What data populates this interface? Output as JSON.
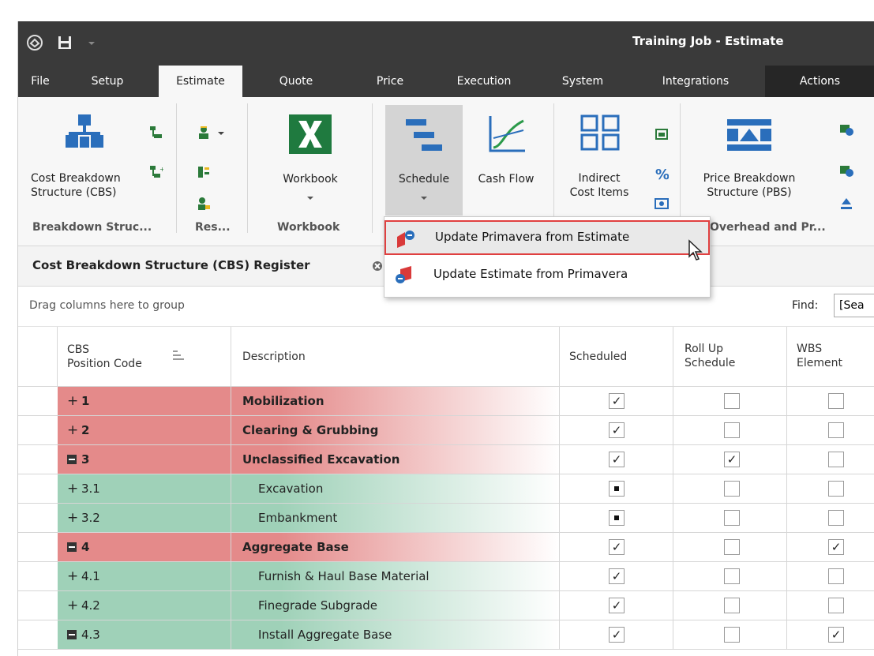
{
  "window": {
    "title": "Training Job - Estimate"
  },
  "menu": {
    "tabs": [
      {
        "label": "File"
      },
      {
        "label": "Setup"
      },
      {
        "label": "Estimate"
      },
      {
        "label": "Quote"
      },
      {
        "label": "Price"
      },
      {
        "label": "Execution"
      },
      {
        "label": "System"
      },
      {
        "label": "Integrations"
      },
      {
        "label": "Actions"
      }
    ],
    "active": "Estimate"
  },
  "ribbon": {
    "cbs_button": "Cost Breakdown\nStructure (CBS)",
    "workbook_button": "Workbook",
    "schedule_button": "Schedule",
    "cashflow_button": "Cash Flow",
    "indirect_button": "Indirect\nCost Items",
    "pbs_button": "Price Breakdown\nStructure (PBS)",
    "groups": {
      "breakdown": "Breakdown Struc...",
      "resources": "Res...",
      "workbook": "Workbook",
      "overhead": "Overhead and Pr..."
    }
  },
  "dropdown": {
    "items": [
      {
        "label": "Update Primavera from Estimate",
        "highlighted": true
      },
      {
        "label": "Update Estimate from Primavera",
        "highlighted": false
      }
    ]
  },
  "panel": {
    "title": "Cost Breakdown Structure (CBS) Register",
    "group_hint": "Drag columns here to group",
    "find_label": "Find:",
    "find_value": "[Sea"
  },
  "grid": {
    "headers": {
      "code": "CBS\nPosition Code",
      "description": "Description",
      "scheduled": "Scheduled",
      "rollup": "Roll Up\nSchedule",
      "wbs": "WBS\nElement"
    },
    "rows": [
      {
        "expander": "+",
        "code": "1",
        "description": "Mobilization",
        "level": 0,
        "scheduled": "checked",
        "rollup": "unchecked",
        "wbs": "unchecked"
      },
      {
        "expander": "+",
        "code": "2",
        "description": "Clearing & Grubbing",
        "level": 0,
        "scheduled": "checked",
        "rollup": "unchecked",
        "wbs": "unchecked"
      },
      {
        "expander": "-",
        "code": "3",
        "description": "Unclassified Excavation",
        "level": 0,
        "scheduled": "checked",
        "rollup": "checked",
        "wbs": "unchecked"
      },
      {
        "expander": "+",
        "code": "3.1",
        "description": "Excavation",
        "level": 1,
        "scheduled": "indeterminate",
        "rollup": "unchecked",
        "wbs": "unchecked"
      },
      {
        "expander": "+",
        "code": "3.2",
        "description": "Embankment",
        "level": 1,
        "scheduled": "indeterminate",
        "rollup": "unchecked",
        "wbs": "unchecked"
      },
      {
        "expander": "-",
        "code": "4",
        "description": "Aggregate Base",
        "level": 0,
        "scheduled": "checked",
        "rollup": "unchecked",
        "wbs": "checked"
      },
      {
        "expander": "+",
        "code": "4.1",
        "description": "Furnish & Haul Base Material",
        "level": 1,
        "scheduled": "checked",
        "rollup": "unchecked",
        "wbs": "unchecked"
      },
      {
        "expander": "+",
        "code": "4.2",
        "description": "Finegrade Subgrade",
        "level": 1,
        "scheduled": "checked",
        "rollup": "unchecked",
        "wbs": "unchecked"
      },
      {
        "expander": "-",
        "code": "4.3",
        "description": "Install Aggregate Base",
        "level": 1,
        "scheduled": "checked",
        "rollup": "unchecked",
        "wbs": "checked"
      }
    ]
  },
  "colors": {
    "titlebar": "#3a3a3a",
    "level0_row": "#e48a8a",
    "level1_row": "#9fd1b8",
    "highlight_border": "#e04040"
  }
}
